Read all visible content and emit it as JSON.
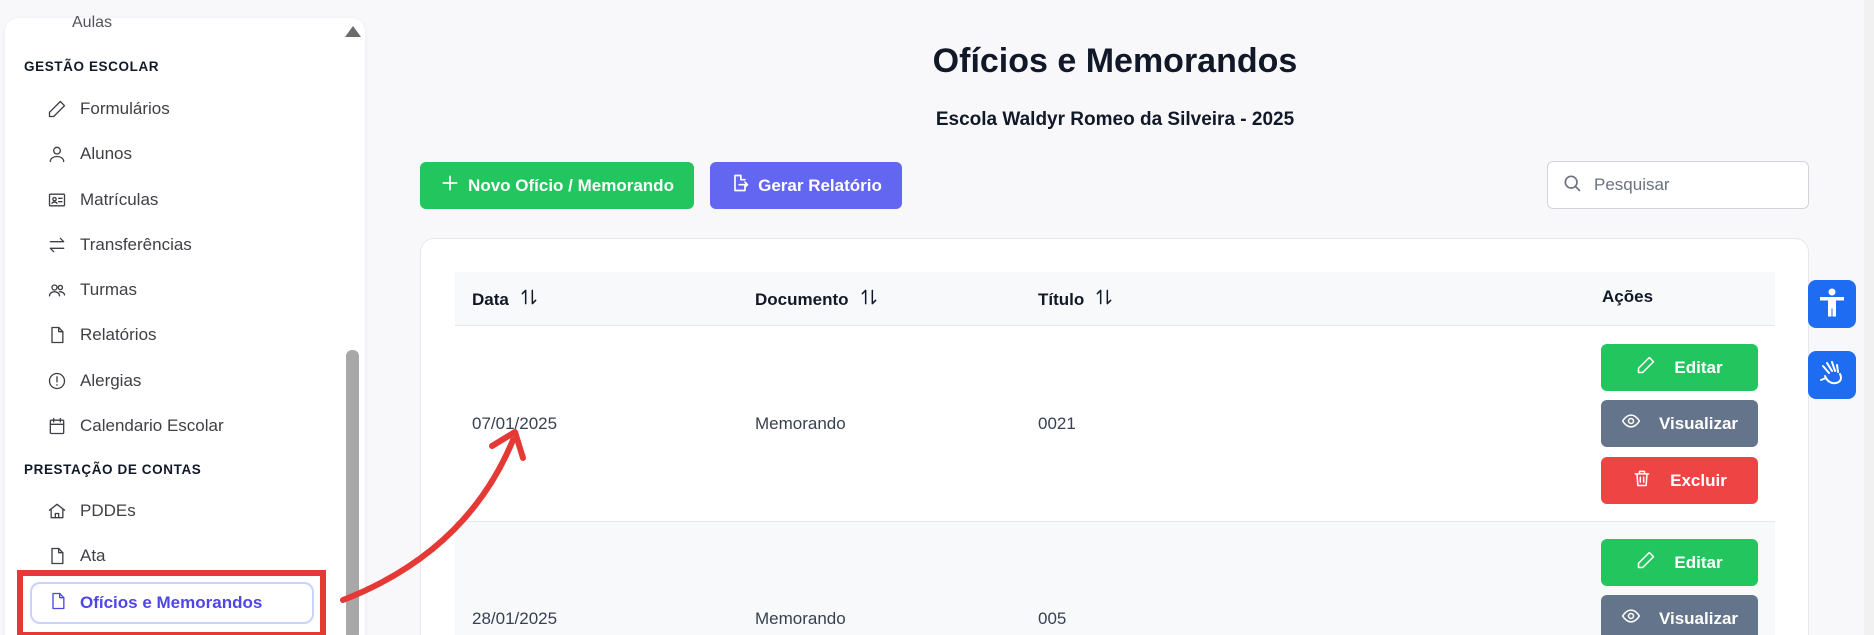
{
  "sidebar": {
    "partial_item": "Aulas",
    "sections": [
      {
        "heading": "GESTÃO ESCOLAR",
        "items": [
          {
            "label": "Formulários",
            "icon": "pencil-icon"
          },
          {
            "label": "Alunos",
            "icon": "user-icon"
          },
          {
            "label": "Matrículas",
            "icon": "id-card-icon"
          },
          {
            "label": "Transferências",
            "icon": "transfer-icon"
          },
          {
            "label": "Turmas",
            "icon": "users-icon"
          },
          {
            "label": "Relatórios",
            "icon": "file-icon"
          },
          {
            "label": "Alergias",
            "icon": "alert-circle-icon"
          },
          {
            "label": "Calendario Escolar",
            "icon": "calendar-icon"
          }
        ]
      },
      {
        "heading": "PRESTAÇÃO DE CONTAS",
        "items": [
          {
            "label": "PDDEs",
            "icon": "home-icon"
          },
          {
            "label": "Ata",
            "icon": "file-icon"
          },
          {
            "label": "Ofícios e Memorandos",
            "icon": "file-icon",
            "active": true
          }
        ]
      }
    ]
  },
  "header": {
    "title": "Ofícios e Memorandos",
    "school": "Escola Waldyr Romeo da Silveira - 2025"
  },
  "toolbar": {
    "new_label": "Novo Ofício / Memorando",
    "report_label": "Gerar Relatório",
    "search_placeholder": "Pesquisar"
  },
  "table": {
    "columns": [
      "Data",
      "Documento",
      "Título",
      "Ações"
    ],
    "rows": [
      {
        "data": "07/01/2025",
        "documento": "Memorando",
        "titulo": "0021"
      },
      {
        "data": "28/01/2025",
        "documento": "Memorando",
        "titulo": "005"
      }
    ],
    "actions": {
      "edit": "Editar",
      "view": "Visualizar",
      "delete": "Excluir"
    }
  },
  "colors": {
    "green": "#22c55e",
    "indigo": "#6366f1",
    "slate": "#64748b",
    "red": "#ef4444",
    "annotation_red": "#e53935",
    "accessibility_blue": "#1d6cf2"
  }
}
